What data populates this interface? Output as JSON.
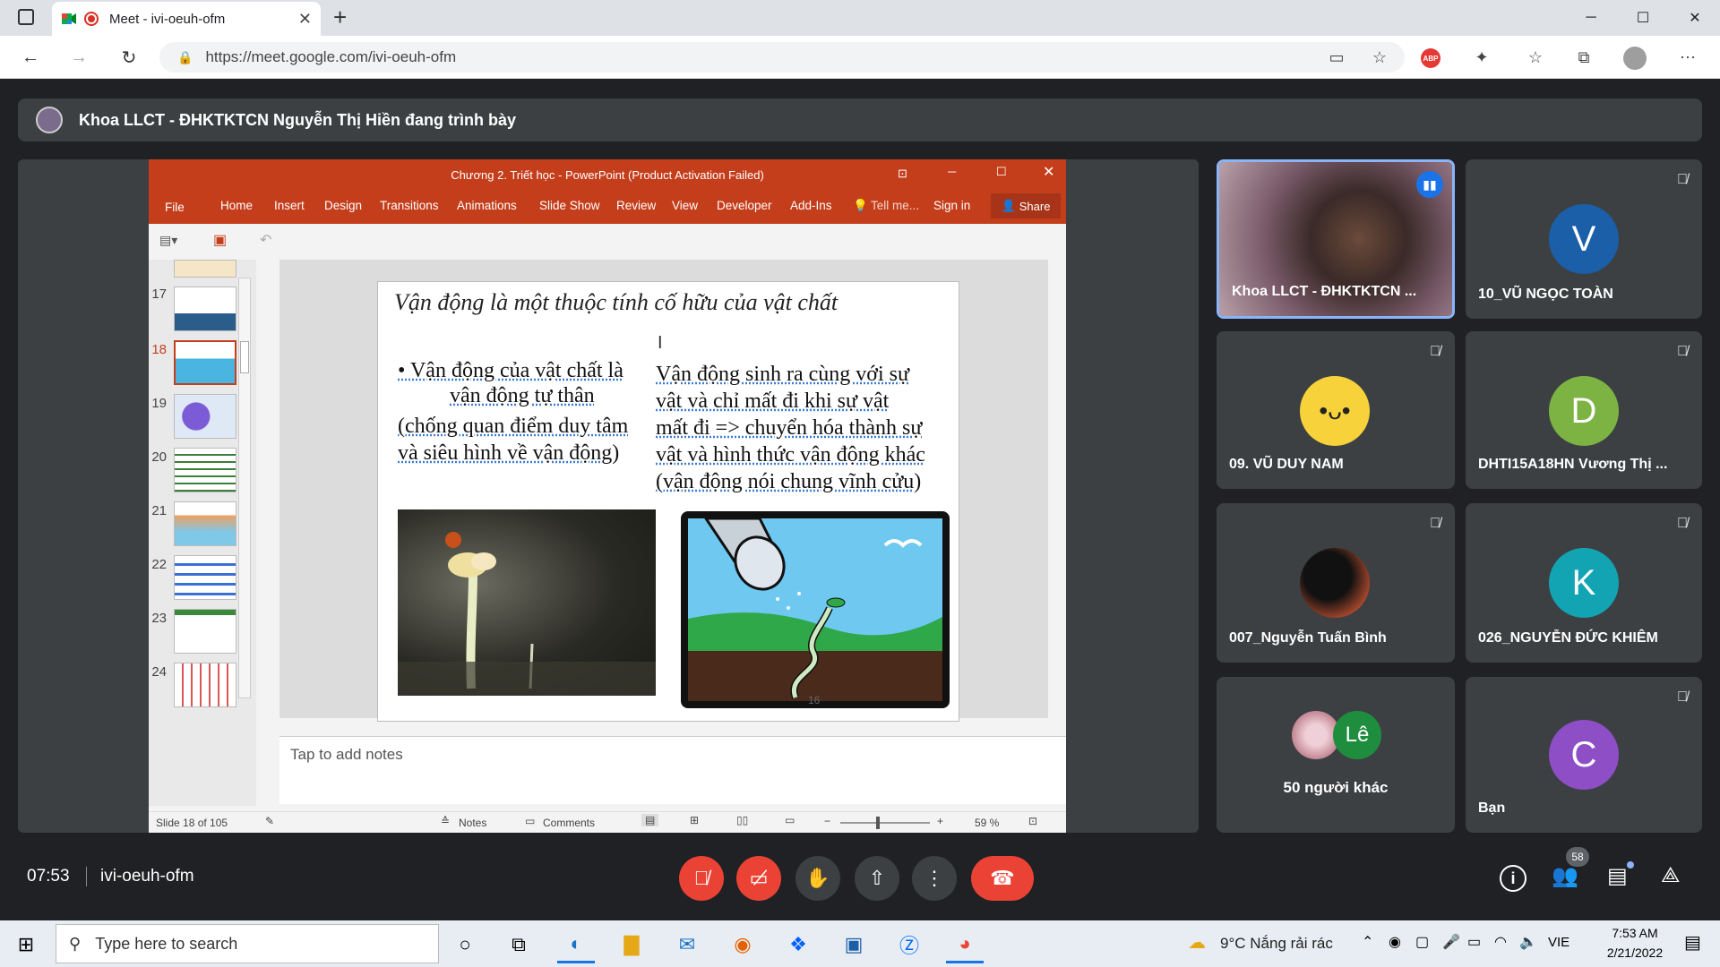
{
  "browser": {
    "tab_title": "Meet - ivi-oeuh-ofm",
    "url": "https://meet.google.com/ivi-oeuh-ofm",
    "new_tab": "+",
    "window_controls": [
      "─",
      "☐",
      "✕"
    ]
  },
  "meet": {
    "banner": "Khoa LLCT - ĐHKTKTCN Nguyễn Thị Hiền đang trình bày",
    "time": "07:53",
    "meeting_code": "ivi-oeuh-ofm",
    "people_count": "58"
  },
  "ppt": {
    "window_title": "Chương 2. Triết học - PowerPoint (Product Activation Failed)",
    "menu": [
      "File",
      "Home",
      "Insert",
      "Design",
      "Transitions",
      "Animations",
      "Slide Show",
      "Review",
      "View",
      "Developer",
      "Add-Ins",
      "Tell me...",
      "Sign in"
    ],
    "share": "Share",
    "thumb_numbers": [
      "17",
      "18",
      "19",
      "20",
      "21",
      "22",
      "23",
      "24"
    ],
    "slide_title": "Vận động là một thuộc tính cố hữu của vật chất",
    "bullet1_line1": "• Vận động của vật chất là",
    "bullet1_line2": "vận động tự thân",
    "bullet1_line3": "(chống quan điểm duy tâm",
    "bullet1_line4": "và  siêu hình về vận động)",
    "right_lines": [
      "Vận động sinh ra cùng với sự",
      "vật và chỉ mất đi khi sự vật",
      "mất đi => chuyển hóa thành sự",
      "vật và hình thức vận động khác",
      "(vận động nói chung vĩnh cửu)"
    ],
    "slide_number": "16",
    "notes_placeholder": "Tap to add notes",
    "status_slide": "Slide 18 of 105",
    "status_notes": "Notes",
    "status_comments": "Comments",
    "zoom": "59 %"
  },
  "participants": [
    {
      "name": "Khoa LLCT - ĐHKTKTCN ...",
      "type": "video"
    },
    {
      "name": "10_VŨ NGỌC TOÀN",
      "initial": "V",
      "color": "#1a5fa8"
    },
    {
      "name": "09. VŨ DUY NAM",
      "type": "pikachu"
    },
    {
      "name": "DHTI15A18HN Vương Thị ...",
      "initial": "D",
      "color": "#7cb342"
    },
    {
      "name": "007_Nguyễn Tuấn Bình",
      "type": "photo"
    },
    {
      "name": "026_NGUYỄN ĐỨC KHIÊM",
      "initial": "K",
      "color": "#12a4b3"
    },
    {
      "name": "50 người khác",
      "initial": "Lê",
      "color": "#1e8e3e"
    },
    {
      "name": "Bạn",
      "initial": "C",
      "color": "#8e4ec6"
    }
  ],
  "taskbar": {
    "search_placeholder": "Type here to search",
    "weather": "9°C  Nắng rải rác",
    "language": "VIE",
    "clock_time": "7:53 AM",
    "clock_date": "2/21/2022"
  }
}
